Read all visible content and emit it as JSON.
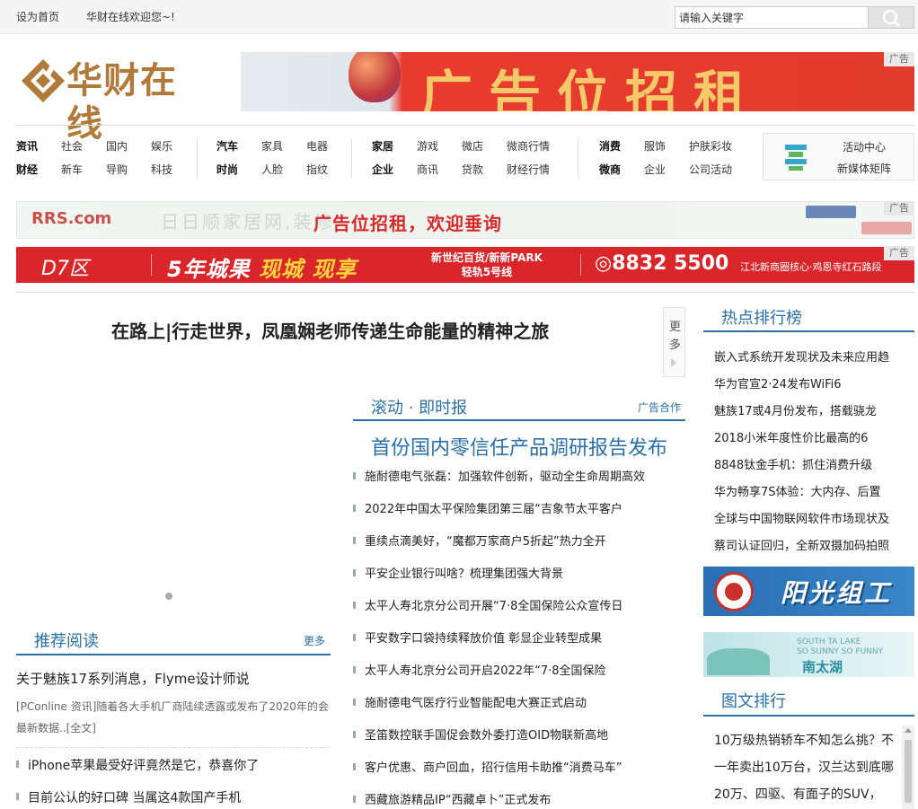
{
  "topbar": {
    "set_home": "设为首页",
    "welcome": "华财在线欢迎您~!",
    "search_placeholder": "请输入关键字"
  },
  "logo": {
    "text": "华财在线"
  },
  "banner1": {
    "text": "广告位招租",
    "ad_tag": "广告"
  },
  "nav": {
    "row1": [
      "资讯",
      "社会",
      "国内",
      "娱乐",
      "汽车",
      "家具",
      "电器",
      "家居",
      "游戏",
      "微店",
      "微商行情",
      "消费",
      "服饰",
      "护肤彩妆"
    ],
    "row2": [
      "财经",
      "新车",
      "导购",
      "科技",
      "时尚",
      "人脸",
      "指纹",
      "企业",
      "商讯",
      "贷款",
      "财经行情",
      "微商",
      "企业",
      "公司活动"
    ]
  },
  "activity": {
    "line1": "活动中心",
    "line2": "新媒体矩阵"
  },
  "ad2": {
    "brand": "RRS.com",
    "ghost": "日日顺家居网,装修",
    "text": "广告位招租，欢迎垂询",
    "ad_tag": "广告"
  },
  "ad3": {
    "brand": "D7区",
    "slogan_a": "5年城果 ",
    "slogan_b": "现城 现享",
    "mid_line1": "新世纪百货/新新PARK",
    "mid_line2": "轻轨5号线",
    "phone": "◎8832 5500",
    "address": "江北新商圈核心·鸡恩寺红石路段",
    "ad_tag": "广告"
  },
  "headline": "在路上|行走世界，凤凰娴老师传递生命能量的精神之旅",
  "more_box": {
    "c1": "更",
    "c2": "多"
  },
  "recommend": {
    "title": "推荐阅读",
    "more": "更多",
    "lead_title": "关于魅族17系列消息，Flyme设计师说",
    "lead_desc": "[PConline 资讯]随着各大手机厂商陆续透露或发布了2020年的会最新数据..[全文]",
    "items": [
      "iPhone苹果最受好评竟然是它，恭喜你了",
      "目前公认的好口碑 当属这4款国产手机"
    ]
  },
  "news": {
    "title": "滚动 · 即时报",
    "ad_link": "广告合作",
    "big": "首份国内零信任产品调研报告发布",
    "items": [
      "施耐德电气张磊：加强软件创新，驱动全生命周期高效",
      "2022年中国太平保险集团第三届“吉象节太平客户",
      "重续点滴美好，“魔都万家商户5折起”热力全开",
      "平安企业银行叫啥？梳理集团强大背景",
      "太平人寿北京分公司开展“7·8全国保险公众宣传日",
      "平安数字口袋持续释放价值 彰显企业转型成果",
      "太平人寿北京分公司开启2022年“7·8全国保险",
      "施耐德电气医疗行业智能配电大赛正式启动",
      "圣笛数控联手国促会数外委打造OID物联新高地",
      "客户优惠、商户回血，招行信用卡助推“消费马车”",
      "西藏旅游精品IP“西藏卓卜”正式发布"
    ]
  },
  "hot": {
    "title": "热点排行榜",
    "items": [
      "嵌入式系统开发现状及未来应用趋",
      "华为官宣2·24发布WiFi6",
      "魅族17或4月份发布，搭载骁龙",
      "2018小米年度性价比最高的6",
      "8848钛金手机：抓住消费升级",
      "华为畅享7S体验：大内存、后置",
      "全球与中国物联网软件市场现状及",
      "蔡司认证回归，全新双摄加码拍照"
    ]
  },
  "sun_ad": {
    "text": "阳光组工"
  },
  "lake_ad": {
    "line1": "SOUTH TA LAKE",
    "line2": "SO SUNNY SO FUNNY",
    "name": "南太湖"
  },
  "pic_rank": {
    "title": "图文排行",
    "lines": [
      "10万级热销轿车不知怎么挑？不",
      "一年卖出10万台，汉兰达到底哪",
      "20万、四驱、有面子的SUV，"
    ]
  },
  "colors": {
    "accent": "#2a6fa8",
    "ad_red": "#d8262a",
    "logo_gold": "#b07a3a"
  }
}
